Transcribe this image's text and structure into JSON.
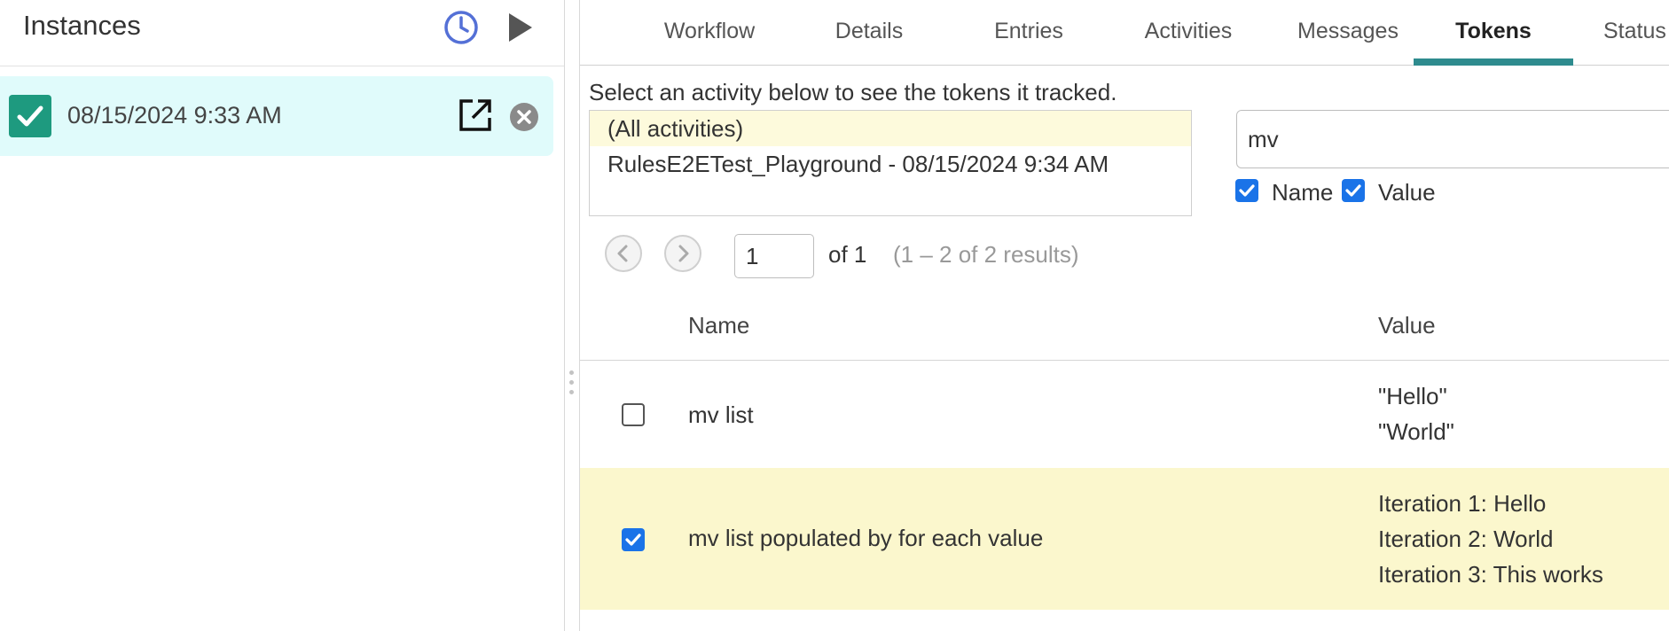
{
  "left_panel": {
    "title": "Instances",
    "instance": {
      "date": "08/15/2024 9:33 AM",
      "checked": true
    }
  },
  "tabs": [
    {
      "label": "Workflow",
      "active": false
    },
    {
      "label": "Details",
      "active": false
    },
    {
      "label": "Entries",
      "active": false
    },
    {
      "label": "Activities",
      "active": false
    },
    {
      "label": "Messages",
      "active": false
    },
    {
      "label": "Tokens",
      "active": true
    },
    {
      "label": "Status",
      "active": false
    }
  ],
  "tokens": {
    "instruction": "Select an activity below to see the tokens it tracked.",
    "activities": [
      {
        "label": "(All activities)",
        "selected": true
      },
      {
        "label": "RulesE2ETest_Playground - 08/15/2024 9:34 AM",
        "selected": false
      }
    ],
    "search": {
      "value": "mv"
    },
    "filters": {
      "name_label": "Name",
      "name_checked": true,
      "value_label": "Value",
      "value_checked": true
    },
    "pager": {
      "page": "1",
      "of_text": "of 1",
      "results_text": "(1 – 2 of 2 results)"
    },
    "columns": {
      "name": "Name",
      "value": "Value"
    },
    "rows": [
      {
        "name": "mv list",
        "checked": false,
        "highlighted": false,
        "values": [
          "\"Hello\"",
          "\"World\""
        ]
      },
      {
        "name": "mv list populated by for each value",
        "checked": true,
        "highlighted": true,
        "values": [
          "Iteration 1: Hello",
          "Iteration 2: World",
          "Iteration 3: This works"
        ]
      }
    ]
  },
  "colors": {
    "accent": "#2e8b8e",
    "instance_bg": "#e0fbfb",
    "highlight_row": "#fbf7cd",
    "checkbox": "#1a73e8",
    "instance_check": "#1e9a7f"
  },
  "icons": {
    "history": "clock-icon",
    "run": "play-icon",
    "open": "open-external-icon",
    "remove": "close-circle-icon"
  }
}
